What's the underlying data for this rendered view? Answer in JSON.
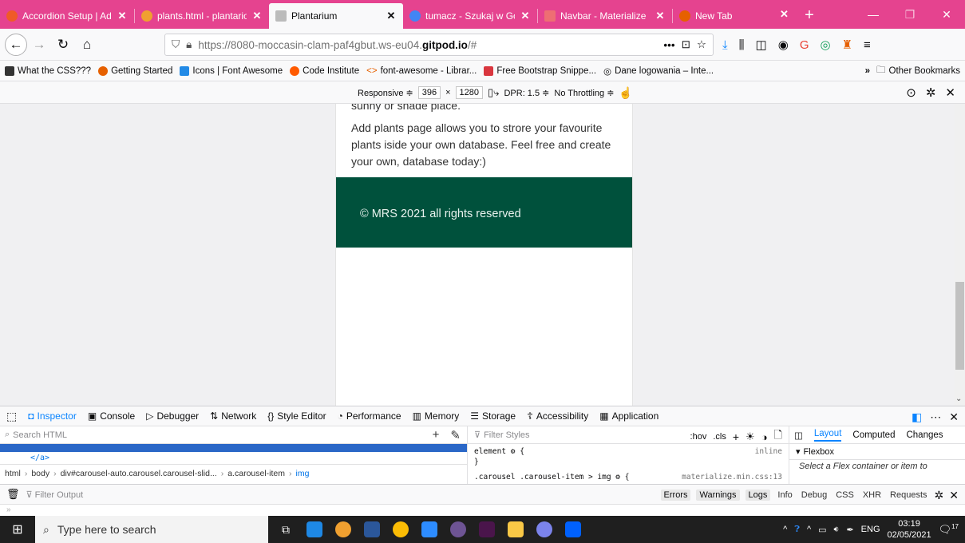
{
  "tabs": [
    {
      "label": "Accordion Setup | Adc",
      "color": "#f05a28"
    },
    {
      "label": "plants.html - plantario",
      "color": "#f0a030"
    },
    {
      "label": "Plantarium",
      "color": "#bbbbbb",
      "active": true
    },
    {
      "label": "tumacz - Szukaj w Goo",
      "color": "#4285f4"
    },
    {
      "label": "Navbar - Materialize",
      "color": "#ee6e73"
    },
    {
      "label": "New Tab",
      "color": "#e66000"
    }
  ],
  "nav": {
    "url_prefix": "https://8080-moccasin-clam-paf4gbut.ws-eu04.",
    "url_domain": "gitpod.io",
    "url_suffix": "/#",
    "more": "•••"
  },
  "bookmarks": [
    {
      "label": "What the CSS???",
      "color": "#333333"
    },
    {
      "label": "Getting Started",
      "color": "#e66000"
    },
    {
      "label": "Icons | Font Awesome",
      "color": "#228ae6"
    },
    {
      "label": "Code Institute",
      "color": "#ff5a00"
    },
    {
      "label": "font-awesome - Librar...",
      "color": "#f0a030"
    },
    {
      "label": "Free Bootstrap Snippe...",
      "color": "#d9363e"
    },
    {
      "label": "Dane logowania – Inte...",
      "color": "#555555"
    }
  ],
  "bookmarks_other": "Other Bookmarks",
  "rdm": {
    "device": "Responsive ≑",
    "width": "396",
    "times": "×",
    "height": "1280",
    "dpr": "DPR: 1.5 ≑",
    "throttling": "No Throttling ≑"
  },
  "page": {
    "cut_text": "sunny or shade place.",
    "paragraph": "Add plants page allows you to strore your favourite plants iside your own database. Feel free and create your own, database today:)",
    "footer_text": "© MRS 2021 all rights reserved",
    "footer_color": "#00513c"
  },
  "devtools": {
    "tabs": [
      "Inspector",
      "Console",
      "Debugger",
      "Network",
      "Style Editor",
      "Performance",
      "Memory",
      "Storage",
      "Accessibility",
      "Application"
    ],
    "tab_icons": [
      "◘",
      "▣",
      "▷",
      "⇅",
      "{}",
      "◔",
      "▥",
      "☰",
      "☦",
      "▦"
    ],
    "search_placeholder": "Search HTML",
    "closing_tag": "</a>",
    "breadcrumbs": [
      "html",
      "body",
      "div#carousel-auto.carousel.carousel-slid...",
      "a.carousel-item",
      "img"
    ],
    "filter_styles": "Filter Styles",
    "styles_tools": [
      ":hov",
      ".cls",
      "+"
    ],
    "rule1": "element ⚙ {",
    "rule1_src": "inline",
    "rule2": "}",
    "rule3": ".carousel .carousel-item > img ⚙ {",
    "rule3_src": "materialize.min.css:13",
    "layout_tabs": [
      "Layout",
      "Computed",
      "Changes"
    ],
    "flexbox": "Flexbox",
    "flex_msg": "Select a Flex container or item to",
    "filter_output": "Filter Output",
    "console_filters": [
      "Errors",
      "Warnings",
      "Logs",
      "Info",
      "Debug",
      "CSS",
      "XHR",
      "Requests"
    ],
    "prompt": "»"
  },
  "taskbar": {
    "search": "Type here to search",
    "lang": "ENG",
    "time": "03:19",
    "date": "02/05/2021",
    "notif": "17",
    "apps": [
      "#1e88e5",
      "#f0a030",
      "#2b579a",
      "#fbbc05",
      "#2d8cff",
      "#181717",
      "#4a154b",
      "#f9c846",
      "#7b83eb",
      "#0061fe"
    ]
  }
}
